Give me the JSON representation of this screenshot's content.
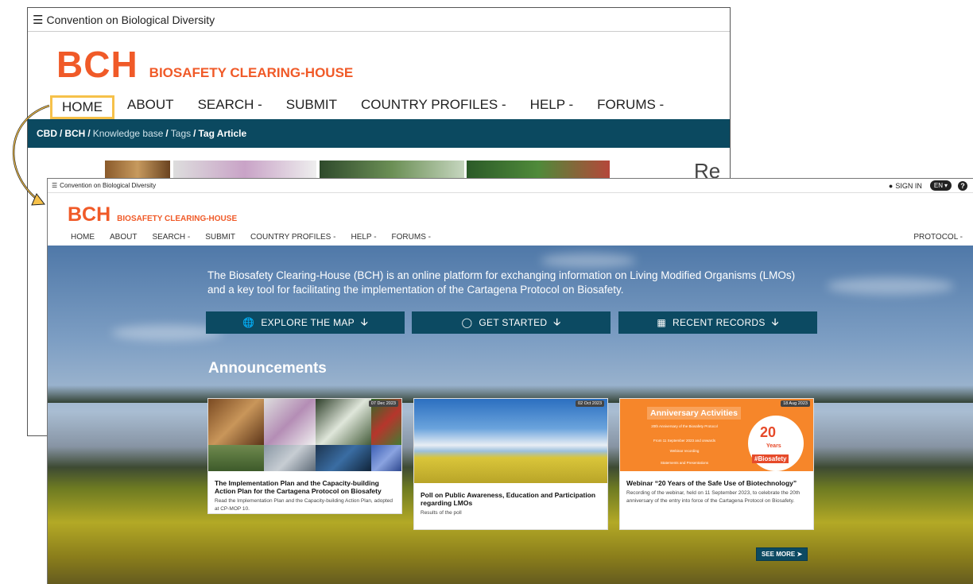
{
  "back_window": {
    "topbar_label": "Convention on Biological Diversity",
    "brand_short": "BCH",
    "brand_long": "BIOSAFETY CLEARING-HOUSE",
    "nav": [
      "HOME",
      "ABOUT",
      "SEARCH -",
      "SUBMIT",
      "COUNTRY PROFILES -",
      "HELP -",
      "FORUMS -"
    ],
    "breadcrumb": [
      "CBD",
      "BCH",
      "Knowledge base",
      "Tags",
      "Tag Article"
    ],
    "partial_heading": "Re",
    "highlight_color": "#f6c14a"
  },
  "front_window": {
    "topbar_label": "Convention on Biological Diversity",
    "sign_in": "SIGN IN",
    "language": "EN",
    "brand_short": "BCH",
    "brand_long": "BIOSAFETY CLEARING-HOUSE",
    "nav": [
      "HOME",
      "ABOUT",
      "SEARCH -",
      "SUBMIT",
      "COUNTRY PROFILES -",
      "HELP -",
      "FORUMS -"
    ],
    "protocol": "PROTOCOL -",
    "intro": "The Biosafety Clearing-House (BCH) is an online platform for exchanging information on Living Modified Organisms (LMOs) and a key tool for facilitating the implementation of the Cartagena Protocol on Biosafety.",
    "buttons": {
      "explore": "EXPLORE THE MAP",
      "started": "GET STARTED",
      "recent": "RECENT RECORDS"
    },
    "announcements_title": "Announcements",
    "cards": [
      {
        "date": "07 Dec 2023",
        "title": "The Implementation Plan and the Capacity-building Action Plan for the Cartagena Protocol on Biosafety",
        "desc": "Read the Implementation Plan and the Capacity-building Action Plan, adopted at CP-MOP 10."
      },
      {
        "date": "02 Oct 2023",
        "title": "Poll on Public Awareness, Education and Participation regarding LMOs",
        "desc": "Results of the poll"
      },
      {
        "date": "18 Aug 2023",
        "title": "Webinar “20 Years of the Safe Use of Biotechnology”",
        "desc": "Recording of the webinar, held on 11 September 2023, to celebrate the 20th anniversary of the entry into force of the Cartagena Protocol on Biosafety.",
        "image_heading": "Anniversary Activities",
        "image_lines": [
          "20th Anniversary of the Biosafety Protocol",
          "From 11 September 2023 and onwards",
          "Webinar recording",
          "Statements and Presentations"
        ],
        "badge_number": "20",
        "badge_years": "Years",
        "badge_hashtag": "#Biosafety"
      }
    ],
    "see_more": "SEE MORE",
    "accent": "#0c4a62",
    "brand_color": "#f05a28"
  },
  "icons": [
    "hamburger-icon",
    "user-icon",
    "help-icon",
    "globe-icon",
    "lightbulb-icon",
    "table-icon",
    "arrow-down-icon",
    "arrow-right-icon"
  ]
}
